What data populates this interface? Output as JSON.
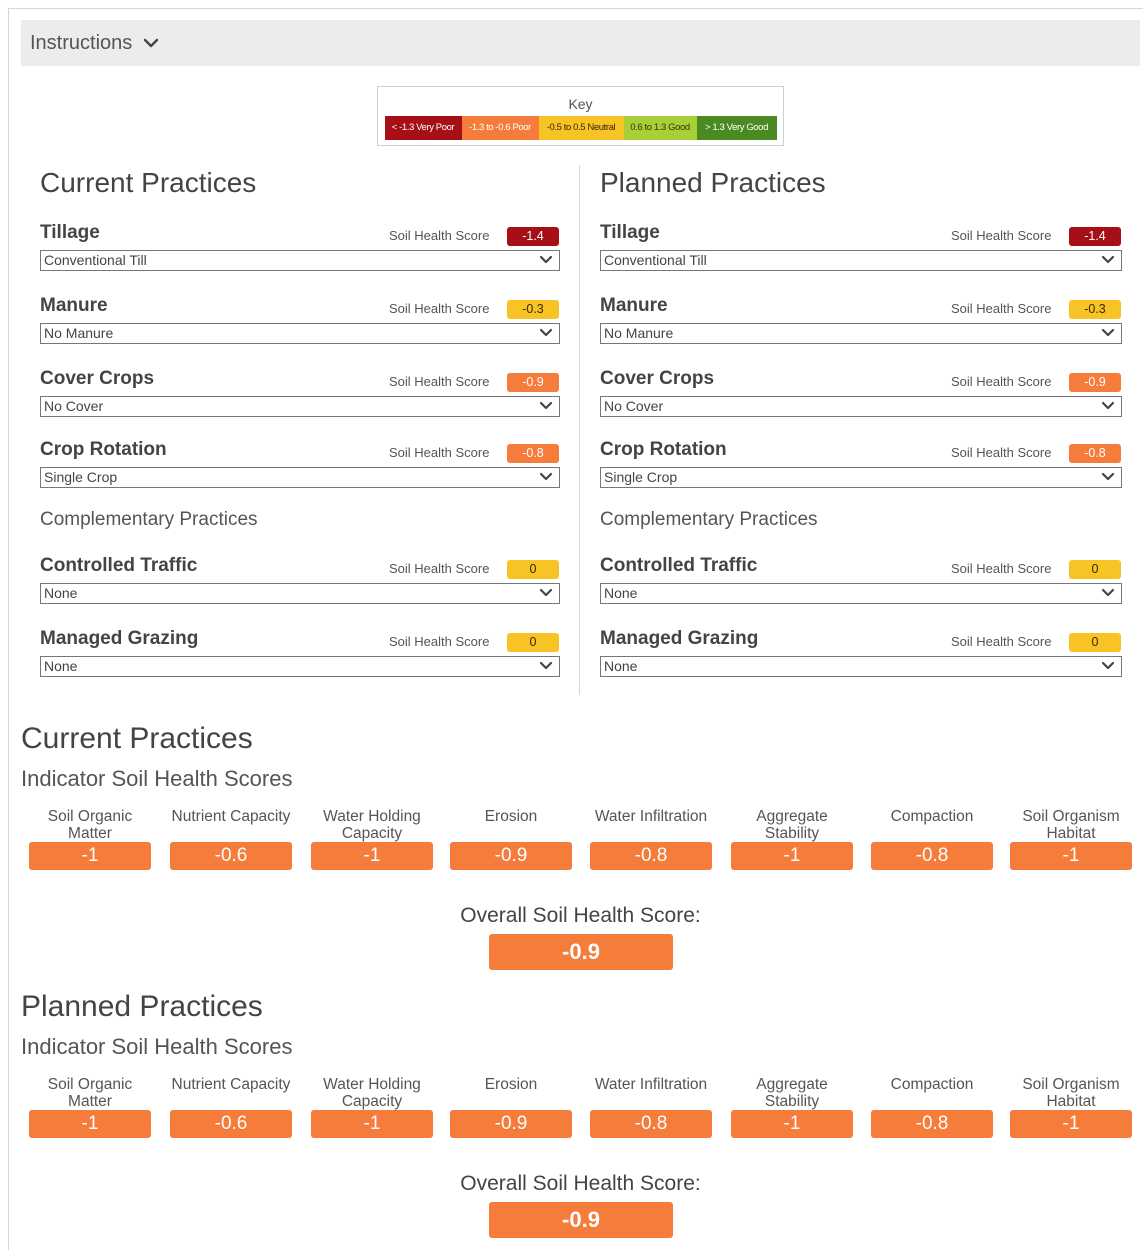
{
  "instructions": {
    "label": "Instructions",
    "icon": "chevron-down-icon"
  },
  "key": {
    "title": "Key",
    "segments": [
      {
        "label": "< -1.3 Very Poor",
        "color": "#a50f15",
        "text_color": "#ffffff"
      },
      {
        "label": "-1.3 to -0.6 Poor",
        "color": "#f57c3a",
        "text_color": "#ffffff"
      },
      {
        "label": "-0.5 to 0.5 Neutral",
        "color": "#f7c325",
        "text_color": "#3a2a00"
      },
      {
        "label": "0.6 to 1.3 Good",
        "color": "#a9cf38",
        "text_color": "#2e3d00"
      },
      {
        "label": "> 1.3 Very Good",
        "color": "#4b8a21",
        "text_color": "#ffffff"
      }
    ]
  },
  "score_label": "Soil Health Score",
  "current": {
    "title": "Current Practices",
    "practices": [
      {
        "name": "Tillage",
        "score": "-1.4",
        "level": "very_poor",
        "value": "Conventional Till"
      },
      {
        "name": "Manure",
        "score": "-0.3",
        "level": "neutral",
        "value": "No Manure"
      },
      {
        "name": "Cover Crops",
        "score": "-0.9",
        "level": "poor",
        "value": "No Cover"
      },
      {
        "name": "Crop Rotation",
        "score": "-0.8",
        "level": "poor",
        "value": "Single Crop"
      }
    ],
    "complementary_label": "Complementary Practices",
    "complementary": [
      {
        "name": "Controlled Traffic",
        "score": "0",
        "level": "neutral",
        "value": "None"
      },
      {
        "name": "Managed Grazing",
        "score": "0",
        "level": "neutral",
        "value": "None"
      }
    ]
  },
  "planned": {
    "title": "Planned Practices",
    "practices": [
      {
        "name": "Tillage",
        "score": "-1.4",
        "level": "very_poor",
        "value": "Conventional Till"
      },
      {
        "name": "Manure",
        "score": "-0.3",
        "level": "neutral",
        "value": "No Manure"
      },
      {
        "name": "Cover Crops",
        "score": "-0.9",
        "level": "poor",
        "value": "No Cover"
      },
      {
        "name": "Crop Rotation",
        "score": "-0.8",
        "level": "poor",
        "value": "Single Crop"
      }
    ],
    "complementary_label": "Complementary Practices",
    "complementary": [
      {
        "name": "Controlled Traffic",
        "score": "0",
        "level": "neutral",
        "value": "None"
      },
      {
        "name": "Managed Grazing",
        "score": "0",
        "level": "neutral",
        "value": "None"
      }
    ]
  },
  "level_colors": {
    "very_poor": "#a50f15",
    "poor": "#f57c3a",
    "neutral": "#f7c325"
  },
  "summaries": [
    {
      "title": "Current Practices",
      "subtitle": "Indicator Soil Health Scores",
      "indicators": [
        {
          "label": "Soil Organic Matter",
          "score": "-1"
        },
        {
          "label": "Nutrient Capacity",
          "score": "-0.6"
        },
        {
          "label": "Water Holding Capacity",
          "score": "-1"
        },
        {
          "label": "Erosion",
          "score": "-0.9"
        },
        {
          "label": "Water Infiltration",
          "score": "-0.8"
        },
        {
          "label": "Aggregate Stability",
          "score": "-1"
        },
        {
          "label": "Compaction",
          "score": "-0.8"
        },
        {
          "label": "Soil Organism Habitat",
          "score": "-1"
        }
      ],
      "overall_label": "Overall Soil Health Score:",
      "overall_score": "-0.9"
    },
    {
      "title": "Planned Practices",
      "subtitle": "Indicator Soil Health Scores",
      "indicators": [
        {
          "label": "Soil Organic Matter",
          "score": "-1"
        },
        {
          "label": "Nutrient Capacity",
          "score": "-0.6"
        },
        {
          "label": "Water Holding Capacity",
          "score": "-1"
        },
        {
          "label": "Erosion",
          "score": "-0.9"
        },
        {
          "label": "Water Infiltration",
          "score": "-0.8"
        },
        {
          "label": "Aggregate Stability",
          "score": "-1"
        },
        {
          "label": "Compaction",
          "score": "-0.8"
        },
        {
          "label": "Soil Organism Habitat",
          "score": "-1"
        }
      ],
      "overall_label": "Overall Soil Health Score:",
      "overall_score": "-0.9"
    }
  ],
  "indicator_color": "#f57c3a"
}
